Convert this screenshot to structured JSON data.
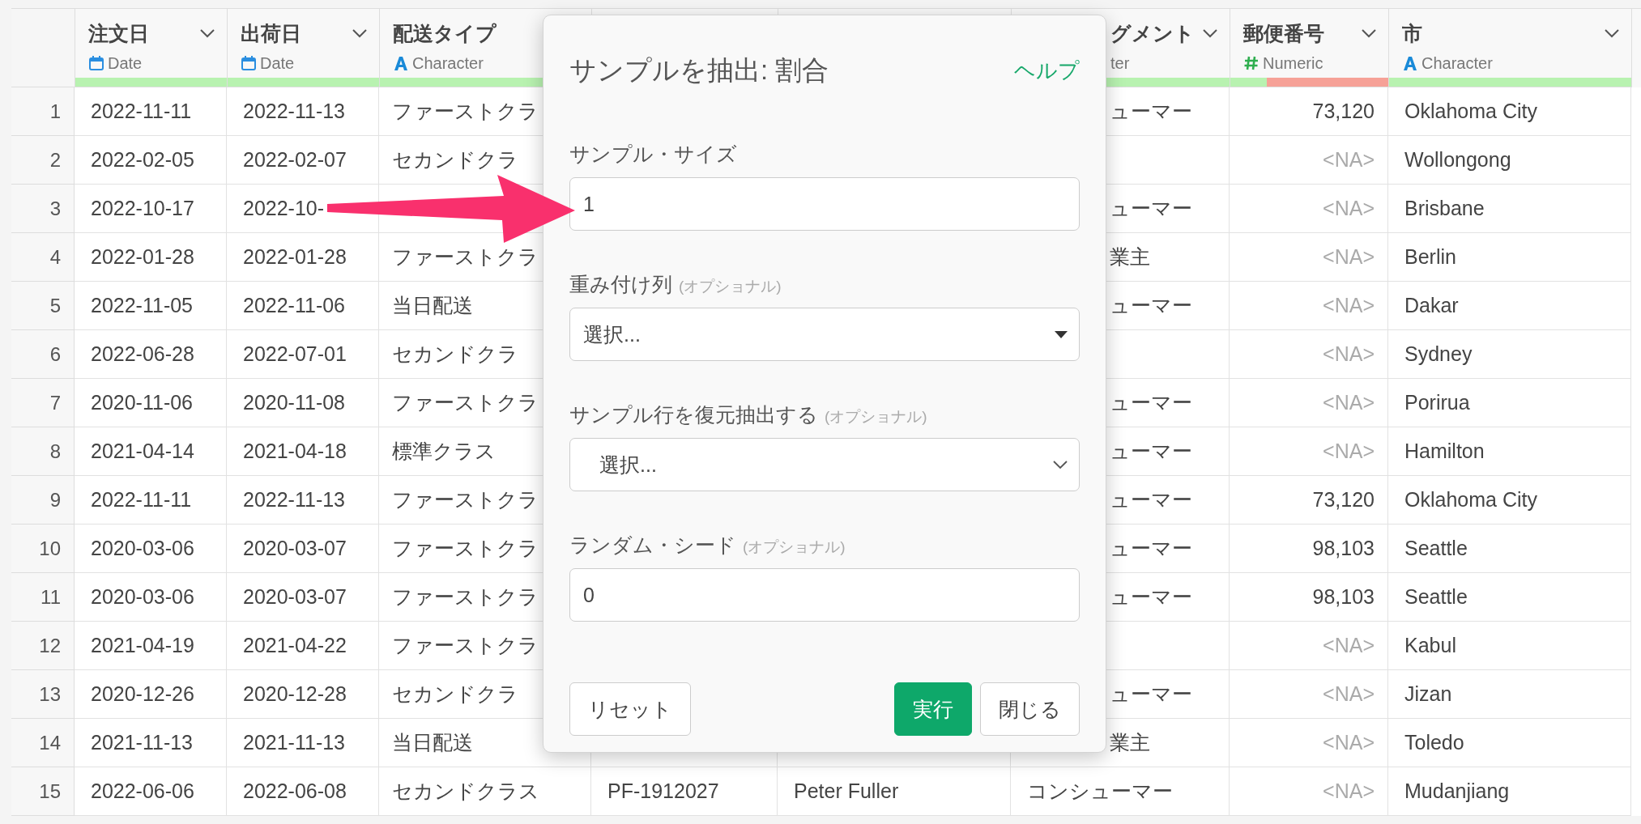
{
  "table": {
    "columns": [
      {
        "name": "注文日",
        "kind": "date",
        "type_label": "Date",
        "level": 1
      },
      {
        "name": "出荷日",
        "kind": "date",
        "type_label": "Date",
        "level": 1
      },
      {
        "name": "配送タイプ",
        "kind": "character",
        "type_label": "Character",
        "level": 1
      },
      null,
      null,
      {
        "name": "グメント",
        "type_label": "ter",
        "level": 1
      },
      {
        "name": "郵便番号",
        "kind": "numeric",
        "type_label": "Numeric",
        "level": 0.23
      },
      {
        "name": "市",
        "kind": "character",
        "type_label": "Character",
        "level": 1
      }
    ],
    "rows": [
      {
        "row": "1",
        "cells": [
          "2022-11-11",
          "2022-11-13",
          "ファーストクラ",
          null,
          null,
          "ューマー",
          "73,120",
          "Oklahoma City"
        ],
        "postal_missing": false
      },
      {
        "row": "2",
        "cells": [
          "2022-02-05",
          "2022-02-07",
          "セカンドクラ",
          null,
          null,
          null,
          "<NA>",
          "Wollongong"
        ],
        "postal_missing": true
      },
      {
        "row": "3",
        "cells": [
          "2022-10-17",
          "2022-10-",
          null,
          null,
          null,
          "ューマー",
          "<NA>",
          "Brisbane"
        ],
        "postal_missing": true
      },
      {
        "row": "4",
        "cells": [
          "2022-01-28",
          "2022-01-28",
          "ファーストクラ",
          null,
          null,
          "業主",
          "<NA>",
          "Berlin"
        ],
        "postal_missing": true
      },
      {
        "row": "5",
        "cells": [
          "2022-11-05",
          "2022-11-06",
          "当日配送",
          null,
          null,
          "ューマー",
          "<NA>",
          "Dakar"
        ],
        "postal_missing": true
      },
      {
        "row": "6",
        "cells": [
          "2022-06-28",
          "2022-07-01",
          "セカンドクラ",
          null,
          null,
          null,
          "<NA>",
          "Sydney"
        ],
        "postal_missing": true
      },
      {
        "row": "7",
        "cells": [
          "2020-11-06",
          "2020-11-08",
          "ファーストクラ",
          null,
          null,
          "ューマー",
          "<NA>",
          "Porirua"
        ],
        "postal_missing": true
      },
      {
        "row": "8",
        "cells": [
          "2021-04-14",
          "2021-04-18",
          "標準クラス",
          null,
          null,
          "ューマー",
          "<NA>",
          "Hamilton"
        ],
        "postal_missing": true
      },
      {
        "row": "9",
        "cells": [
          "2022-11-11",
          "2022-11-13",
          "ファーストクラ",
          null,
          null,
          "ューマー",
          "73,120",
          "Oklahoma City"
        ],
        "postal_missing": false
      },
      {
        "row": "10",
        "cells": [
          "2020-03-06",
          "2020-03-07",
          "ファーストクラ",
          null,
          null,
          "ューマー",
          "98,103",
          "Seattle"
        ],
        "postal_missing": false
      },
      {
        "row": "11",
        "cells": [
          "2020-03-06",
          "2020-03-07",
          "ファーストクラ",
          null,
          null,
          "ューマー",
          "98,103",
          "Seattle"
        ],
        "postal_missing": false
      },
      {
        "row": "12",
        "cells": [
          "2021-04-19",
          "2021-04-22",
          "ファーストクラ",
          null,
          null,
          null,
          "<NA>",
          "Kabul"
        ],
        "postal_missing": true
      },
      {
        "row": "13",
        "cells": [
          "2020-12-26",
          "2020-12-28",
          "セカンドクラ",
          null,
          null,
          "ューマー",
          "<NA>",
          "Jizan"
        ],
        "postal_missing": true
      },
      {
        "row": "14",
        "cells": [
          "2021-11-13",
          "2021-11-13",
          "当日配送",
          null,
          null,
          "業主",
          "<NA>",
          "Toledo"
        ],
        "postal_missing": true
      },
      {
        "row": "15",
        "cells": [
          "2022-06-06",
          "2022-06-08",
          "セカンドクラス",
          "PF-1912027",
          "Peter Fuller",
          "コンシューマー",
          "<NA>",
          "Mudanjiang"
        ],
        "postal_missing": true
      }
    ]
  },
  "dialog": {
    "title": "サンプルを抽出: 割合",
    "help_link": "ヘルプ",
    "fields": [
      {
        "kind": "input",
        "label": "サンプル・サイズ",
        "value": "1"
      },
      {
        "kind": "dropdown",
        "label": "重み付け列",
        "hint": "(オプショナル)",
        "placeholder": "選択..."
      },
      {
        "kind": "select",
        "label": "サンプル行を復元抽出する",
        "hint": "(オプショナル)",
        "placeholder": "選択..."
      },
      {
        "kind": "input",
        "label": "ランダム・シード",
        "hint": "(オプショナル)",
        "value": "0"
      }
    ],
    "buttons": [
      {
        "label": "リセット",
        "kind": "default"
      },
      {
        "label": "実行",
        "kind": "primary"
      },
      {
        "label": "閉じる",
        "kind": "default"
      }
    ]
  }
}
